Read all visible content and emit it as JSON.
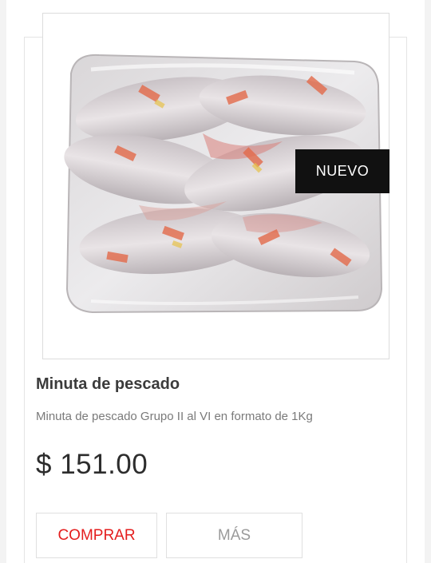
{
  "product": {
    "image_alt": "product-photo-frozen-fish-fillets",
    "badge": "NUEVO",
    "name": "Minuta de pescado",
    "description": "Minuta de pescado Grupo II al VI en formato de 1Kg",
    "price": "$ 151.00",
    "buy_label": "COMPRAR",
    "more_label": "MÁS"
  },
  "colors": {
    "accent": "#e41e1e",
    "badge_bg": "#111111",
    "text_dark": "#3b3b3b",
    "text_muted": "#7a7a7a"
  }
}
